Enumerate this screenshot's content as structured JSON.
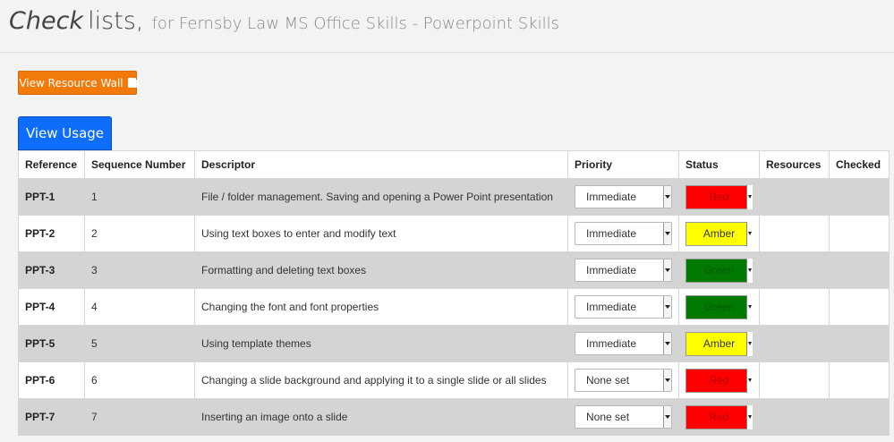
{
  "header": {
    "title_italic": "Check",
    "title_rest": "lists,",
    "subtitle": "for Fernsby Law MS Office Skills - Powerpoint Skills"
  },
  "buttons": {
    "resource_wall": "View Resource Wall",
    "usage": "View Usage"
  },
  "colors": {
    "resource_button": "#f27a0a",
    "usage_button": "#0d6efd",
    "status_red": "#ff0000",
    "status_amber": "#ffff00",
    "status_green": "#007a00"
  },
  "table": {
    "columns": [
      "Reference",
      "Sequence Number",
      "Descriptor",
      "Priority",
      "Status",
      "Resources",
      "Checked"
    ],
    "rows": [
      {
        "reference": "PPT-1",
        "sequence": "1",
        "descriptor": "File / folder management. Saving and opening a Power Point presentation",
        "priority": "Immediate",
        "status": "Red"
      },
      {
        "reference": "PPT-2",
        "sequence": "2",
        "descriptor": "Using text boxes to enter and modify text",
        "priority": "Immediate",
        "status": "Amber"
      },
      {
        "reference": "PPT-3",
        "sequence": "3",
        "descriptor": "Formatting and deleting text boxes",
        "priority": "Immediate",
        "status": "Green"
      },
      {
        "reference": "PPT-4",
        "sequence": "4",
        "descriptor": "Changing the font and font properties",
        "priority": "Immediate",
        "status": "Green"
      },
      {
        "reference": "PPT-5",
        "sequence": "5",
        "descriptor": "Using template themes",
        "priority": "Immediate",
        "status": "Amber"
      },
      {
        "reference": "PPT-6",
        "sequence": "6",
        "descriptor": "Changing a slide background and applying it to a single slide or all slides",
        "priority": "None set",
        "status": "Red"
      },
      {
        "reference": "PPT-7",
        "sequence": "7",
        "descriptor": "Inserting an image onto a slide",
        "priority": "None set",
        "status": "Red"
      }
    ]
  }
}
